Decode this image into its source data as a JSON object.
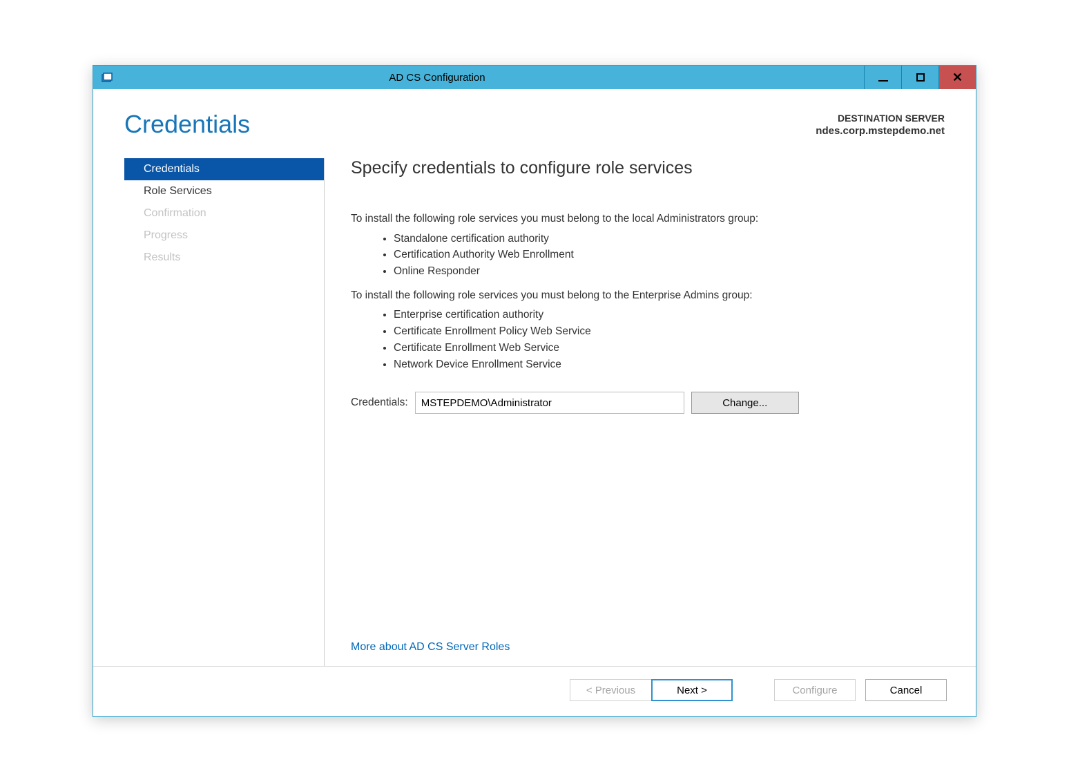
{
  "window": {
    "title": "AD CS Configuration"
  },
  "header": {
    "page_title": "Credentials",
    "dest_label": "DESTINATION SERVER",
    "dest_server": "ndes.corp.mstepdemo.net"
  },
  "sidebar": {
    "items": [
      {
        "label": "Credentials",
        "state": "active"
      },
      {
        "label": "Role Services",
        "state": "enabled"
      },
      {
        "label": "Confirmation",
        "state": "disabled"
      },
      {
        "label": "Progress",
        "state": "disabled"
      },
      {
        "label": "Results",
        "state": "disabled"
      }
    ]
  },
  "content": {
    "heading": "Specify credentials to configure role services",
    "intro_local": "To install the following role services you must belong to the local Administrators group:",
    "local_roles": [
      "Standalone certification authority",
      "Certification Authority Web Enrollment",
      "Online Responder"
    ],
    "intro_enterprise": "To install the following role services you must belong to the Enterprise Admins group:",
    "enterprise_roles": [
      "Enterprise certification authority",
      "Certificate Enrollment Policy Web Service",
      "Certificate Enrollment Web Service",
      "Network Device Enrollment Service"
    ],
    "cred_label": "Credentials:",
    "cred_value": "MSTEPDEMO\\Administrator",
    "change_label": "Change...",
    "help_link": "More about AD CS Server Roles"
  },
  "footer": {
    "previous": "< Previous",
    "next": "Next >",
    "configure": "Configure",
    "cancel": "Cancel"
  }
}
